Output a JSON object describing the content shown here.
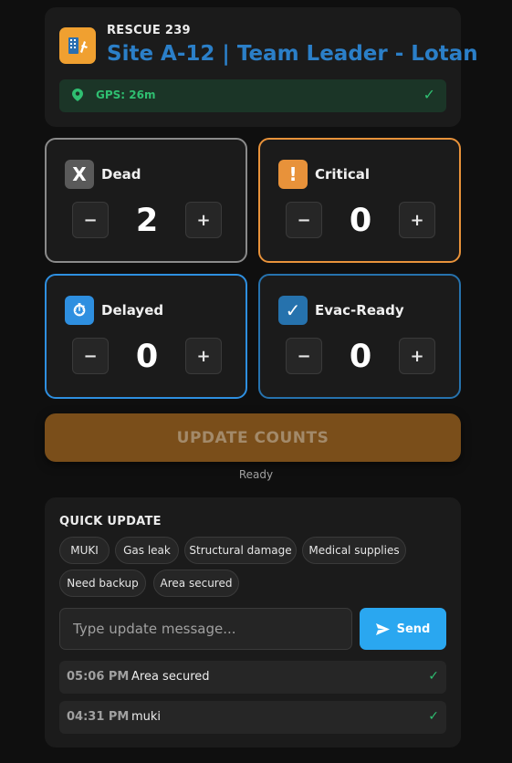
{
  "header": {
    "app_name": "RESCUE 239",
    "site_title": "Site A-12 | Team Leader - Lotan",
    "gps": "GPS: 26m",
    "gps_ok": "✓"
  },
  "counters": [
    {
      "label": "Dead",
      "icon_text": "X",
      "icon": "x-icon",
      "value": "2",
      "color": "#8a8a8a"
    },
    {
      "label": "Critical",
      "icon_text": "!",
      "icon": "exclamation-icon",
      "value": "0",
      "color": "#e8923a"
    },
    {
      "label": "Delayed",
      "icon_text": "⏱",
      "icon": "stopwatch-icon",
      "value": "0",
      "color": "#2e8fe0"
    },
    {
      "label": "Evac-Ready",
      "icon_text": "✓",
      "icon": "checkmark-icon",
      "value": "0",
      "color": "#2672ad"
    }
  ],
  "counter_controls": {
    "minus": "−",
    "plus": "+"
  },
  "update_button": "UPDATE COUNTS",
  "status": "Ready",
  "quick_update": {
    "title": "QUICK UPDATE",
    "chips": [
      "MUKI",
      "Gas leak",
      "Structural damage",
      "Medical supplies",
      "Need backup",
      "Area secured"
    ],
    "input_placeholder": "Type update message...",
    "send_label": "Send",
    "log": [
      {
        "time": "05:06 PM",
        "text": "Area secured",
        "status": "✓"
      },
      {
        "time": "04:31 PM",
        "text": "muki",
        "status": "✓"
      }
    ]
  }
}
